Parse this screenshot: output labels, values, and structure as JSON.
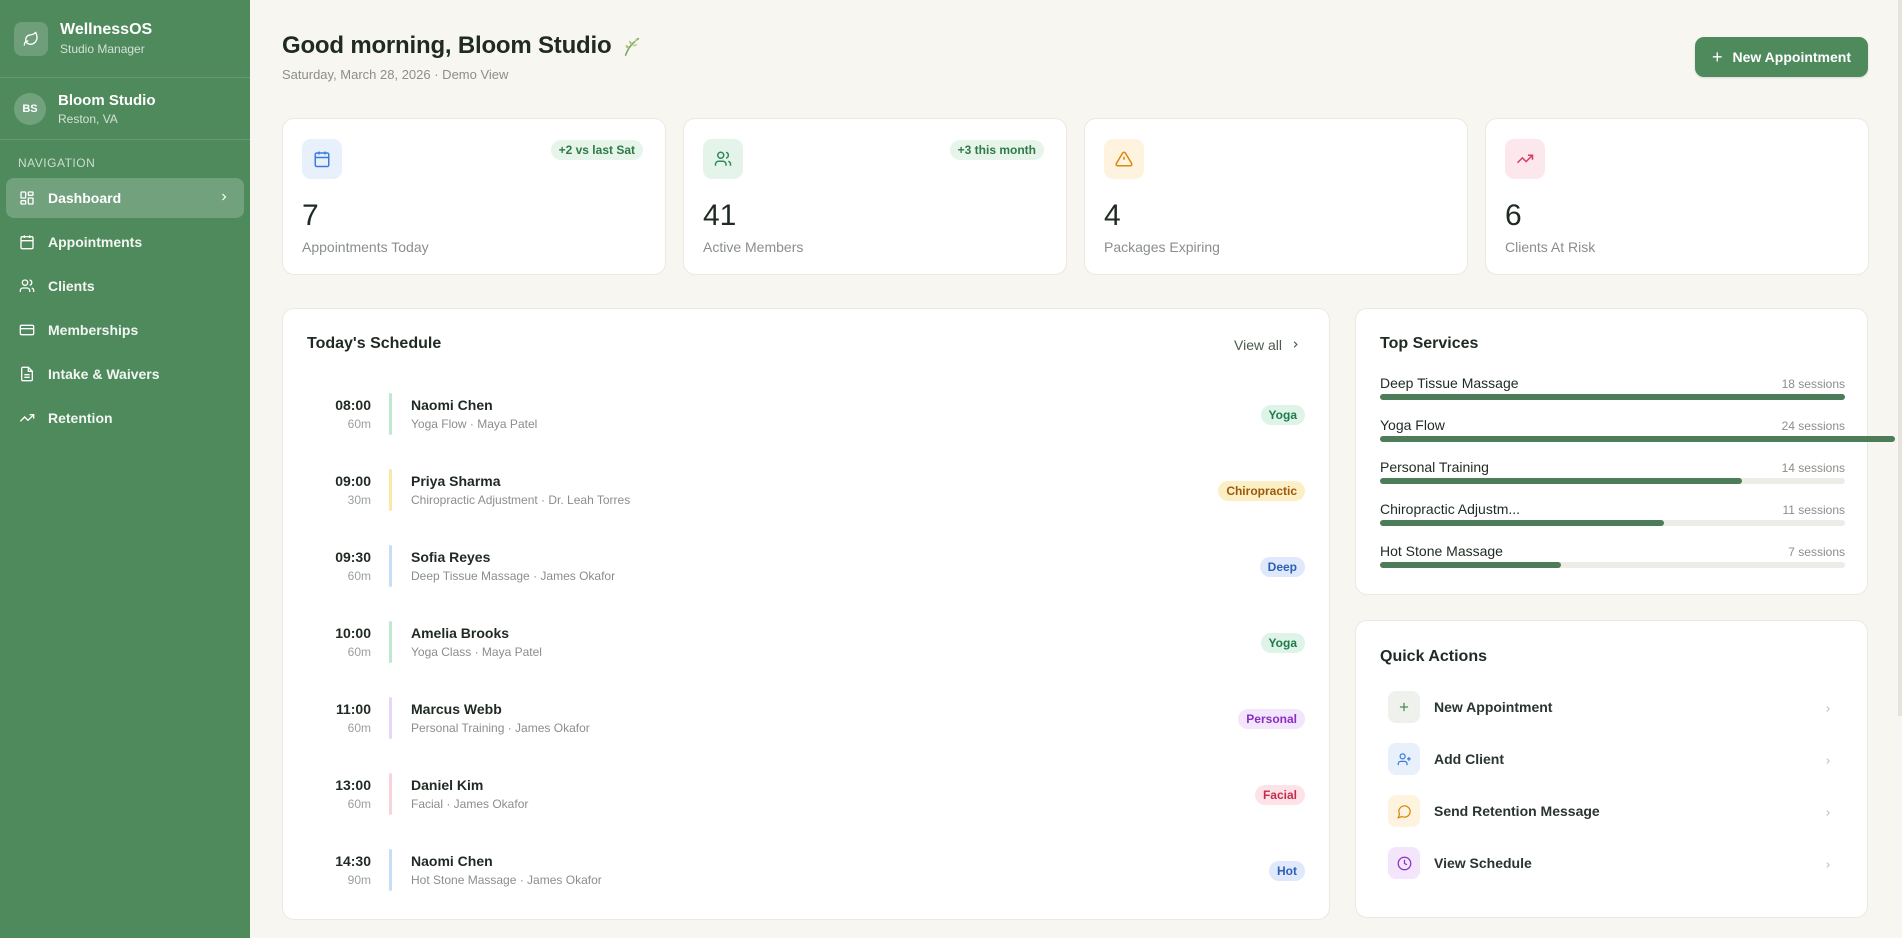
{
  "app": {
    "name": "WellnessOS",
    "subtitle": "Studio Manager"
  },
  "studio": {
    "initials": "BS",
    "name": "Bloom Studio",
    "location": "Reston, VA"
  },
  "nav": {
    "heading": "NAVIGATION",
    "items": [
      {
        "label": "Dashboard",
        "icon": "grid-icon",
        "active": true
      },
      {
        "label": "Appointments",
        "icon": "calendar-icon",
        "active": false
      },
      {
        "label": "Clients",
        "icon": "users-icon",
        "active": false
      },
      {
        "label": "Memberships",
        "icon": "card-icon",
        "active": false
      },
      {
        "label": "Intake & Waivers",
        "icon": "document-icon",
        "active": false
      },
      {
        "label": "Retention",
        "icon": "trending-up-icon",
        "active": false
      }
    ]
  },
  "header": {
    "greeting": "Good morning, Bloom Studio",
    "date": "Saturday, March 28, 2026 · Demo View",
    "new_button": "New Appointment"
  },
  "stats": [
    {
      "value": "7",
      "label": "Appointments Today",
      "badge": "+2 vs last Sat",
      "icon": "calendar-icon",
      "color": "#3b7be0",
      "bg": "#e8f0fc"
    },
    {
      "value": "41",
      "label": "Active Members",
      "badge": "+3 this month",
      "icon": "users-icon",
      "color": "#2f8a57",
      "bg": "#e5f4eb"
    },
    {
      "value": "4",
      "label": "Packages Expiring",
      "badge": "",
      "icon": "alert-triangle-icon",
      "color": "#d9870e",
      "bg": "#fdf3de"
    },
    {
      "value": "6",
      "label": "Clients At Risk",
      "badge": "",
      "icon": "trending-up-icon",
      "color": "#d83a5b",
      "bg": "#fce8ec"
    }
  ],
  "schedule": {
    "title": "Today's Schedule",
    "view_all": "View all",
    "items": [
      {
        "time": "08:00",
        "duration": "60m",
        "name": "Naomi Chen",
        "detail": "Yoga Flow · Maya Patel",
        "tag": "Yoga",
        "bar": "#bfe8cf",
        "tag_color": "#1f7a4a",
        "tag_bg": "#dff4e8"
      },
      {
        "time": "09:00",
        "duration": "30m",
        "name": "Priya Sharma",
        "detail": "Chiropractic Adjustment · Dr. Leah Torres",
        "tag": "Chiropractic",
        "bar": "#fbe7a6",
        "tag_color": "#9a5a08",
        "tag_bg": "#fcefc6"
      },
      {
        "time": "09:30",
        "duration": "60m",
        "name": "Sofia Reyes",
        "detail": "Deep Tissue Massage · James Okafor",
        "tag": "Deep",
        "bar": "#c9dcf7",
        "tag_color": "#2d5fb5",
        "tag_bg": "#dfe9fb"
      },
      {
        "time": "10:00",
        "duration": "60m",
        "name": "Amelia Brooks",
        "detail": "Yoga Class · Maya Patel",
        "tag": "Yoga",
        "bar": "#bfe8cf",
        "tag_color": "#1f7a4a",
        "tag_bg": "#dff4e8"
      },
      {
        "time": "11:00",
        "duration": "60m",
        "name": "Marcus Webb",
        "detail": "Personal Training · James Okafor",
        "tag": "Personal",
        "bar": "#e9d5f7",
        "tag_color": "#8a2fc2",
        "tag_bg": "#f3e5fc"
      },
      {
        "time": "13:00",
        "duration": "60m",
        "name": "Daniel Kim",
        "detail": "Facial · James Okafor",
        "tag": "Facial",
        "bar": "#f9d3da",
        "tag_color": "#c22d4c",
        "tag_bg": "#fde3e8"
      },
      {
        "time": "14:30",
        "duration": "90m",
        "name": "Naomi Chen",
        "detail": "Hot Stone Massage · James Okafor",
        "tag": "Hot",
        "bar": "#c9dcf7",
        "tag_color": "#2d5fb5",
        "tag_bg": "#dfe9fb"
      }
    ]
  },
  "top_services": {
    "title": "Top Services",
    "items": [
      {
        "name": "Deep Tissue Massage",
        "count": "18 sessions",
        "sessions": 18
      },
      {
        "name": "Yoga Flow",
        "count": "24 sessions",
        "sessions": 24
      },
      {
        "name": "Personal Training",
        "count": "14 sessions",
        "sessions": 14
      },
      {
        "name": "Chiropractic Adjustm...",
        "count": "11 sessions",
        "sessions": 11
      },
      {
        "name": "Hot Stone Massage",
        "count": "7 sessions",
        "sessions": 7
      }
    ]
  },
  "quick_actions": {
    "title": "Quick Actions",
    "items": [
      {
        "label": "New Appointment",
        "icon": "plus-icon",
        "color": "#4f8a5d",
        "bg": "#eef1ec"
      },
      {
        "label": "Add Client",
        "icon": "user-plus-icon",
        "color": "#3b7be0",
        "bg": "#e8f0fc"
      },
      {
        "label": "Send Retention Message",
        "icon": "message-icon",
        "color": "#d9870e",
        "bg": "#fdf3de"
      },
      {
        "label": "View Schedule",
        "icon": "clock-icon",
        "color": "#8a2fc2",
        "bg": "#f3e5fc"
      }
    ]
  }
}
